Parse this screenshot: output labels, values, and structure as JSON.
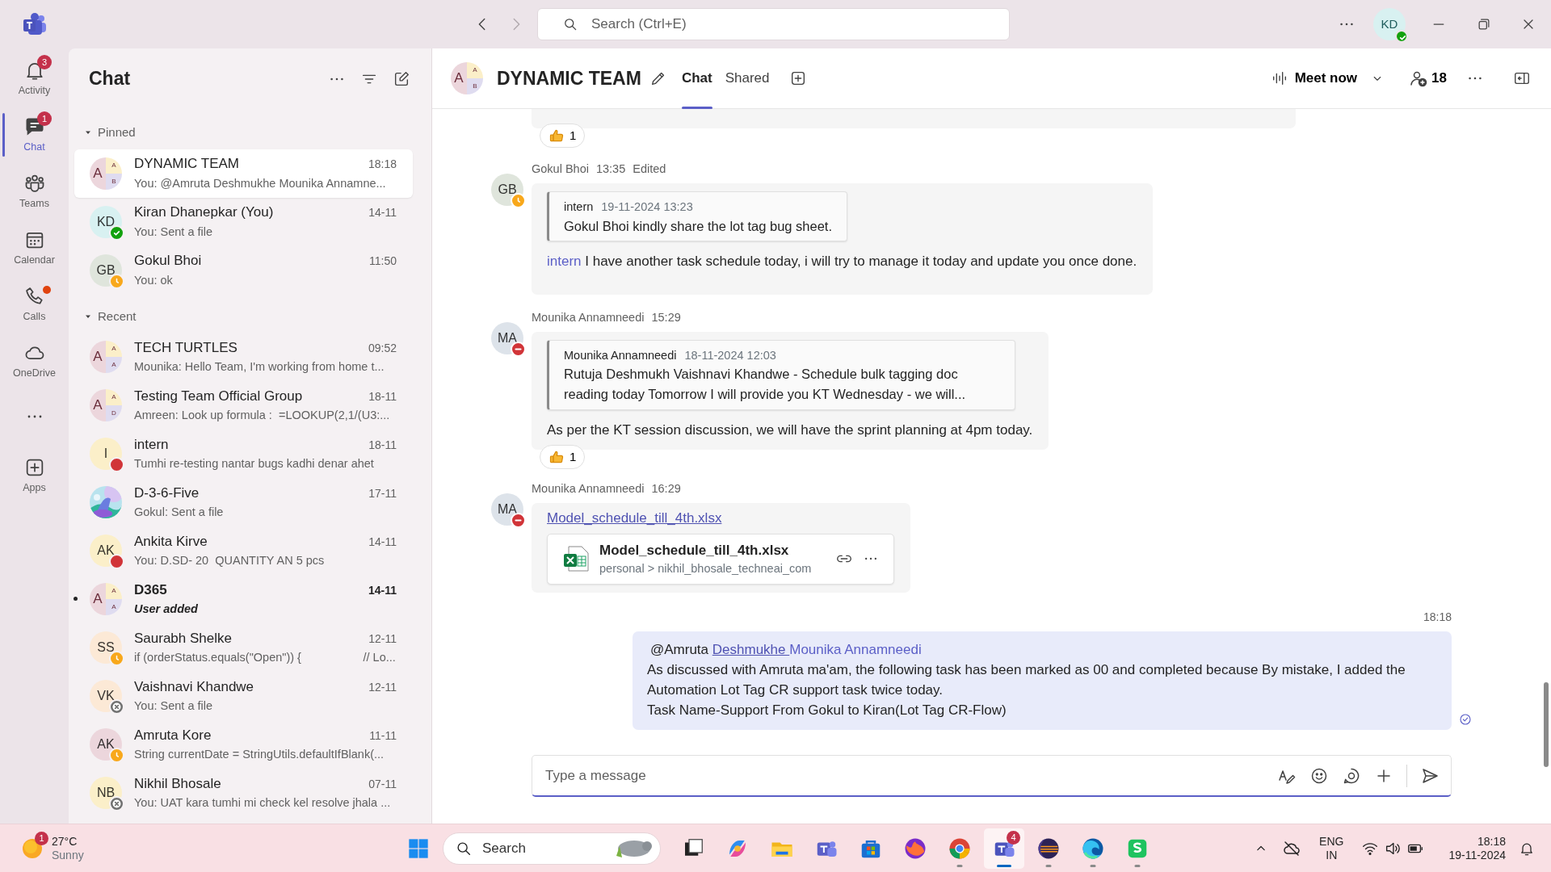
{
  "title_bar": {
    "search_placeholder": "Search (Ctrl+E)",
    "avatar_initials": "KD",
    "presence": {
      "kind": "available",
      "color": "#13a10e"
    }
  },
  "rail": [
    {
      "kind": "app",
      "label": "Activity",
      "badge": "3",
      "alert_dot": false,
      "selected": false
    },
    {
      "kind": "app",
      "label": "Chat",
      "badge": "1",
      "alert_dot": false,
      "selected": true
    },
    {
      "kind": "app",
      "label": "Teams",
      "alert_dot": false,
      "selected": false
    },
    {
      "kind": "app",
      "label": "Calendar",
      "alert_dot": false,
      "selected": false
    },
    {
      "kind": "app",
      "label": "Calls",
      "alert_dot": true,
      "selected": false
    },
    {
      "kind": "app",
      "label": "OneDrive",
      "alert_dot": false,
      "selected": false
    },
    {
      "kind": "more"
    },
    {
      "kind": "app",
      "label": "Apps",
      "alert_dot": false,
      "selected": false
    }
  ],
  "chat_list": {
    "title": "Chat",
    "sections": [
      {
        "title": "Pinned",
        "expanded": true,
        "items": [
          {
            "kind": "group",
            "letters": [
              "A",
              "A",
              "B"
            ],
            "name": "DYNAMIC TEAM",
            "time": "18:18",
            "preview": "You: @Amruta Deshmukhe Mounika Annamne...",
            "selected": true,
            "unread": false
          },
          {
            "kind": "person",
            "initials": "KD",
            "color": "#d8f1f1",
            "presence": {
              "kind": "available",
              "color": "#13a10e"
            },
            "name": "Kiran Dhanepkar (You)",
            "time": "14-11",
            "preview": "You: Sent a file",
            "selected": false,
            "unread": false
          },
          {
            "kind": "person",
            "initials": "GB",
            "color": "#dfe5dc",
            "presence": {
              "kind": "away",
              "color": "#f8a81b"
            },
            "name": "Gokul Bhoi",
            "time": "11:50",
            "preview": "You: ok",
            "selected": false,
            "unread": false
          }
        ]
      },
      {
        "title": "Recent",
        "expanded": true,
        "items": [
          {
            "kind": "group",
            "letters": [
              "A",
              "A",
              "A"
            ],
            "name": "TECH TURTLES",
            "time": "09:52",
            "preview": "Mounika: Hello Team, I'm working from home t...",
            "selected": false,
            "unread": false
          },
          {
            "kind": "group",
            "letters": [
              "A",
              "A",
              "D"
            ],
            "name": "Testing Team Official Group",
            "time": "18-11",
            "preview": "Amreen: Look up formula :  =LOOKUP(2,1/(U3:...",
            "selected": false,
            "unread": false
          },
          {
            "kind": "person",
            "initials": "I",
            "color": "#fbefc9",
            "presence": {
              "kind": "busy",
              "color": "#d13438"
            },
            "name": "intern",
            "time": "18-11",
            "preview": "Tumhi re-testing nantar bugs kadhi denar ahet",
            "selected": false,
            "unread": false
          },
          {
            "kind": "picture",
            "name": "D-3-6-Five",
            "time": "17-11",
            "preview": "Gokul: Sent a file",
            "selected": false,
            "unread": false
          },
          {
            "kind": "person",
            "initials": "AK",
            "color": "#fbefc9",
            "presence": {
              "kind": "busy",
              "color": "#d13438"
            },
            "name": "Ankita Kirve",
            "time": "14-11",
            "preview": "You: D.SD- 20  QUANTITY AN 5 pcs",
            "selected": false,
            "unread": false
          },
          {
            "kind": "group",
            "letters": [
              "A",
              "A",
              "A"
            ],
            "name": "D365",
            "time": "14-11",
            "preview": "User added",
            "selected": false,
            "unread": true
          },
          {
            "kind": "person",
            "initials": "SS",
            "color": "#fce9d6",
            "presence": {
              "kind": "away",
              "color": "#f8a81b"
            },
            "name": "Saurabh Shelke",
            "time": "12-11",
            "preview": "if (orderStatus.equals(\"Open\")) {                   // Lo...",
            "selected": false,
            "unread": false
          },
          {
            "kind": "person",
            "initials": "VK",
            "color": "#fce9d6",
            "presence": {
              "kind": "offline",
              "color": "#707070"
            },
            "name": "Vaishnavi Khandwe",
            "time": "12-11",
            "preview": "You: Sent a file",
            "selected": false,
            "unread": false
          },
          {
            "kind": "person",
            "initials": "AK",
            "color": "#ecd6dc",
            "presence": {
              "kind": "away",
              "color": "#f8a81b"
            },
            "name": "Amruta Kore",
            "time": "11-11",
            "preview": "String currentDate = StringUtils.defaultIfBlank(...",
            "selected": false,
            "unread": false
          },
          {
            "kind": "person",
            "initials": "NB",
            "color": "#fbefc9",
            "presence": {
              "kind": "offline",
              "color": "#707070"
            },
            "name": "Nikhil Bhosale",
            "time": "07-11",
            "preview": "You: UAT kara tumhi mi check kel resolve jhala ...",
            "selected": false,
            "unread": false
          }
        ]
      }
    ]
  },
  "header": {
    "letters": [
      "A",
      "A",
      "B"
    ],
    "title": "DYNAMIC TEAM",
    "tabs": [
      {
        "label": "Chat",
        "selected": true
      },
      {
        "label": "Shared",
        "selected": false
      }
    ],
    "meet_label": "Meet now",
    "participants": "18"
  },
  "messages": [
    {
      "kind": "partial",
      "reaction": {
        "count": "1"
      }
    },
    {
      "kind": "text",
      "author": "Gokul Bhoi",
      "initials": "GB",
      "color": "#dfe5dc",
      "presence": {
        "kind": "away",
        "color": "#f8a81b"
      },
      "time": "13:35",
      "edited": "Edited",
      "quote": {
        "author": "intern",
        "time": "19-11-2024 13:23",
        "text": "Gokul Bhoi kindly share the lot tag bug sheet."
      },
      "body": [
        {
          "kind": "mention",
          "text": "intern"
        },
        {
          "kind": "plain",
          "text": " I have another task schedule today,  i will try to manage it today and update you once done."
        }
      ]
    },
    {
      "kind": "text",
      "author": "Mounika Annamneedi",
      "initials": "MA",
      "color": "#dde3ea",
      "presence": {
        "kind": "dnd",
        "color": "#d13438"
      },
      "time": "15:29",
      "quote": {
        "author": "Mounika Annamneedi",
        "time": "18-11-2024 12:03",
        "text": "Rutuja Deshmukh Vaishnavi Khandwe - Schedule bulk tagging doc reading today Tomorrow I will provide you KT Wednesday - we will..."
      },
      "body": [
        {
          "kind": "plain",
          "text": "As per the KT session discussion, we will have the sprint planning at 4pm today."
        }
      ],
      "reaction": {
        "count": "1"
      }
    },
    {
      "kind": "file",
      "author": "Mounika Annamneedi",
      "initials": "MA",
      "color": "#dde3ea",
      "presence": {
        "kind": "dnd",
        "color": "#d13438"
      },
      "time": "16:29",
      "link": "Model_schedule_till_4th.xlsx",
      "file": {
        "name": "Model_schedule_till_4th.xlsx",
        "path": "personal > nikhil_bhosale_techneai_com"
      }
    },
    {
      "kind": "own",
      "time": "18:18",
      "seen": true,
      "lines": [
        [
          {
            "kind": "plain",
            "text": "@Amruta "
          },
          {
            "kind": "link",
            "text": "Deshmukhe "
          },
          {
            "kind": "mention",
            "text": "Mounika Annamneedi"
          }
        ],
        [
          {
            "kind": "plain",
            "text": "As discussed with Amruta ma'am, the following task has been marked as 00 and completed because By mistake, I added the Automation Lot Tag CR support task twice today."
          }
        ],
        [
          {
            "kind": "plain",
            "text": "Task Name-Support From Gokul to Kiran(Lot Tag CR-Flow)"
          }
        ]
      ]
    }
  ],
  "compose": {
    "placeholder": "Type a message"
  },
  "taskbar": {
    "weather": {
      "temp": "27°C",
      "condition": "Sunny",
      "badge": "1"
    },
    "search_placeholder": "Search",
    "apps": [
      {
        "running": false,
        "selected": false
      },
      {
        "running": false,
        "selected": false
      },
      {
        "running": false,
        "selected": false
      },
      {
        "running": false,
        "selected": false
      },
      {
        "running": false,
        "selected": false
      },
      {
        "running": false,
        "selected": false
      },
      {
        "running": true,
        "selected": false
      },
      {
        "running": true,
        "selected": true,
        "badge": "4"
      },
      {
        "running": true,
        "selected": false
      },
      {
        "running": true,
        "selected": false
      },
      {
        "running": true,
        "selected": false
      }
    ],
    "tray": {
      "language": "ENG",
      "region": "IN",
      "time": "18:18",
      "date": "19-11-2024"
    }
  }
}
